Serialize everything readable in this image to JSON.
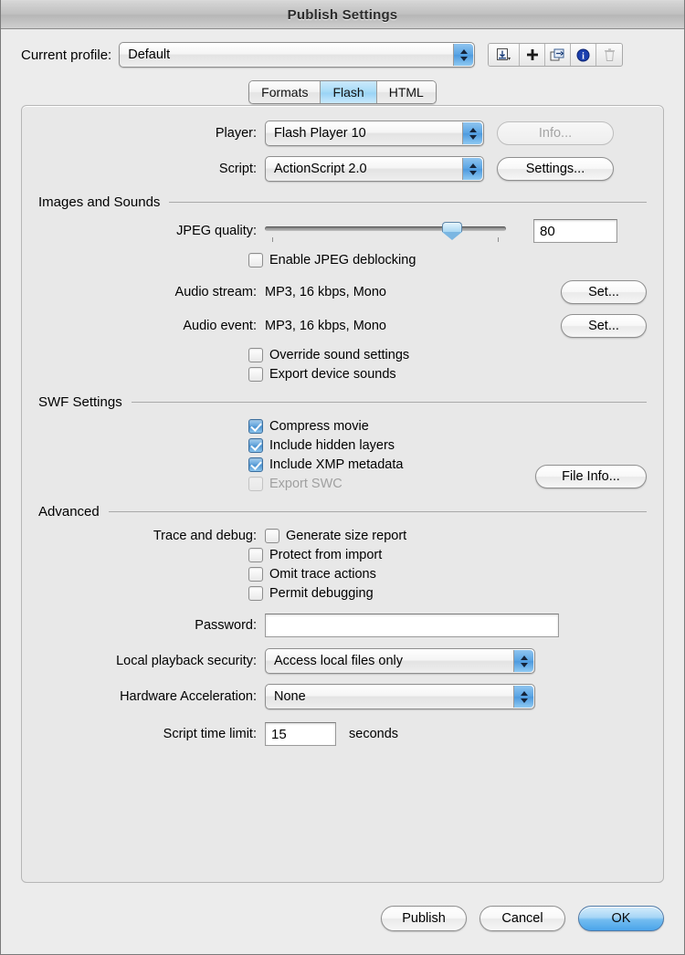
{
  "window": {
    "title": "Publish Settings"
  },
  "profile": {
    "label": "Current profile:",
    "value": "Default",
    "toolbar_icons": [
      "import-profile-icon",
      "add-profile-icon",
      "duplicate-profile-icon",
      "profile-properties-icon",
      "delete-profile-icon"
    ]
  },
  "tabs": [
    {
      "label": "Formats",
      "active": false
    },
    {
      "label": "Flash",
      "active": true
    },
    {
      "label": "HTML",
      "active": false
    }
  ],
  "player": {
    "label": "Player:",
    "value": "Flash Player 10",
    "info_button": "Info..."
  },
  "script": {
    "label": "Script:",
    "value": "ActionScript 2.0",
    "settings_button": "Settings..."
  },
  "images_and_sounds": {
    "group_title": "Images and Sounds",
    "jpeg_quality": {
      "label": "JPEG quality:",
      "value": "80",
      "slider_percent": 80
    },
    "enable_jpeg_deblocking": {
      "label": "Enable JPEG deblocking",
      "checked": false
    },
    "audio_stream": {
      "label": "Audio stream:",
      "value": "MP3, 16 kbps, Mono",
      "button": "Set..."
    },
    "audio_event": {
      "label": "Audio event:",
      "value": "MP3, 16 kbps, Mono",
      "button": "Set..."
    },
    "override_sound_settings": {
      "label": "Override sound settings",
      "checked": false
    },
    "export_device_sounds": {
      "label": "Export device sounds",
      "checked": false
    }
  },
  "swf_settings": {
    "group_title": "SWF Settings",
    "compress_movie": {
      "label": "Compress movie",
      "checked": true
    },
    "include_hidden_layers": {
      "label": "Include hidden layers",
      "checked": true
    },
    "include_xmp_metadata": {
      "label": "Include XMP metadata",
      "checked": true
    },
    "export_swc": {
      "label": "Export SWC",
      "checked": false,
      "disabled": true
    },
    "file_info_button": "File Info..."
  },
  "advanced": {
    "group_title": "Advanced",
    "trace_and_debug_label": "Trace and debug:",
    "generate_size_report": {
      "label": "Generate size report",
      "checked": false
    },
    "protect_from_import": {
      "label": "Protect from import",
      "checked": false
    },
    "omit_trace_actions": {
      "label": "Omit trace actions",
      "checked": false
    },
    "permit_debugging": {
      "label": "Permit debugging",
      "checked": false
    },
    "password": {
      "label": "Password:",
      "value": ""
    },
    "local_playback_security": {
      "label": "Local playback security:",
      "value": "Access local files only"
    },
    "hardware_acceleration": {
      "label": "Hardware Acceleration:",
      "value": "None"
    },
    "script_time_limit": {
      "label": "Script time limit:",
      "value": "15",
      "unit": "seconds"
    }
  },
  "footer": {
    "publish": "Publish",
    "cancel": "Cancel",
    "ok": "OK"
  },
  "colors": {
    "accent_blue": "#4a92d0",
    "window_bg": "#ececec",
    "panel_bg": "#e8e8e8"
  }
}
